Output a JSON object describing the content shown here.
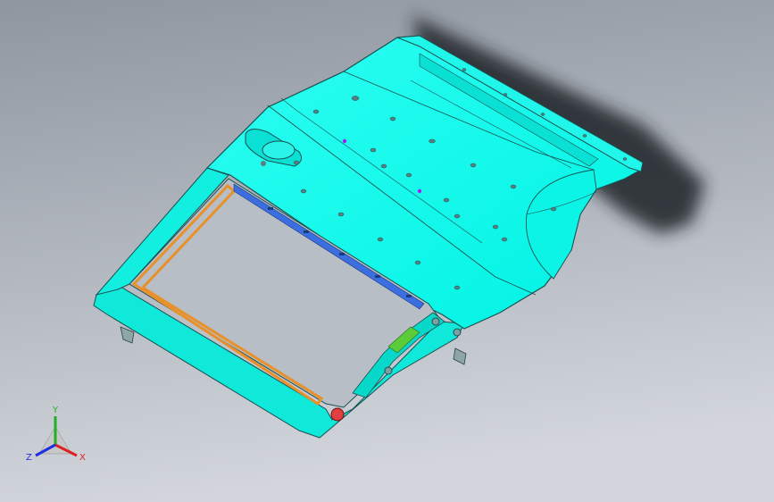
{
  "scene": {
    "model": "car-door-panel",
    "render_style": "shaded-with-edges",
    "colors": {
      "background_top": "#8f96a0",
      "background_bottom": "#cfd4da",
      "panel_fill": "#00ffee",
      "panel_edge": "#1a5050",
      "shadow": "#1e2328",
      "frame_orange": "#e8902a",
      "frame_blue": "#3b6fe0",
      "hole": "#5a7f80",
      "hole_purple": "#a020f0",
      "accent_green": "#5acc3a",
      "bolt_red": "#e04040"
    }
  },
  "triad": {
    "x_label": "X",
    "y_label": "Y",
    "z_label": "Z",
    "x_color": "#e02020",
    "y_color": "#20b020",
    "z_color": "#2030e0"
  }
}
